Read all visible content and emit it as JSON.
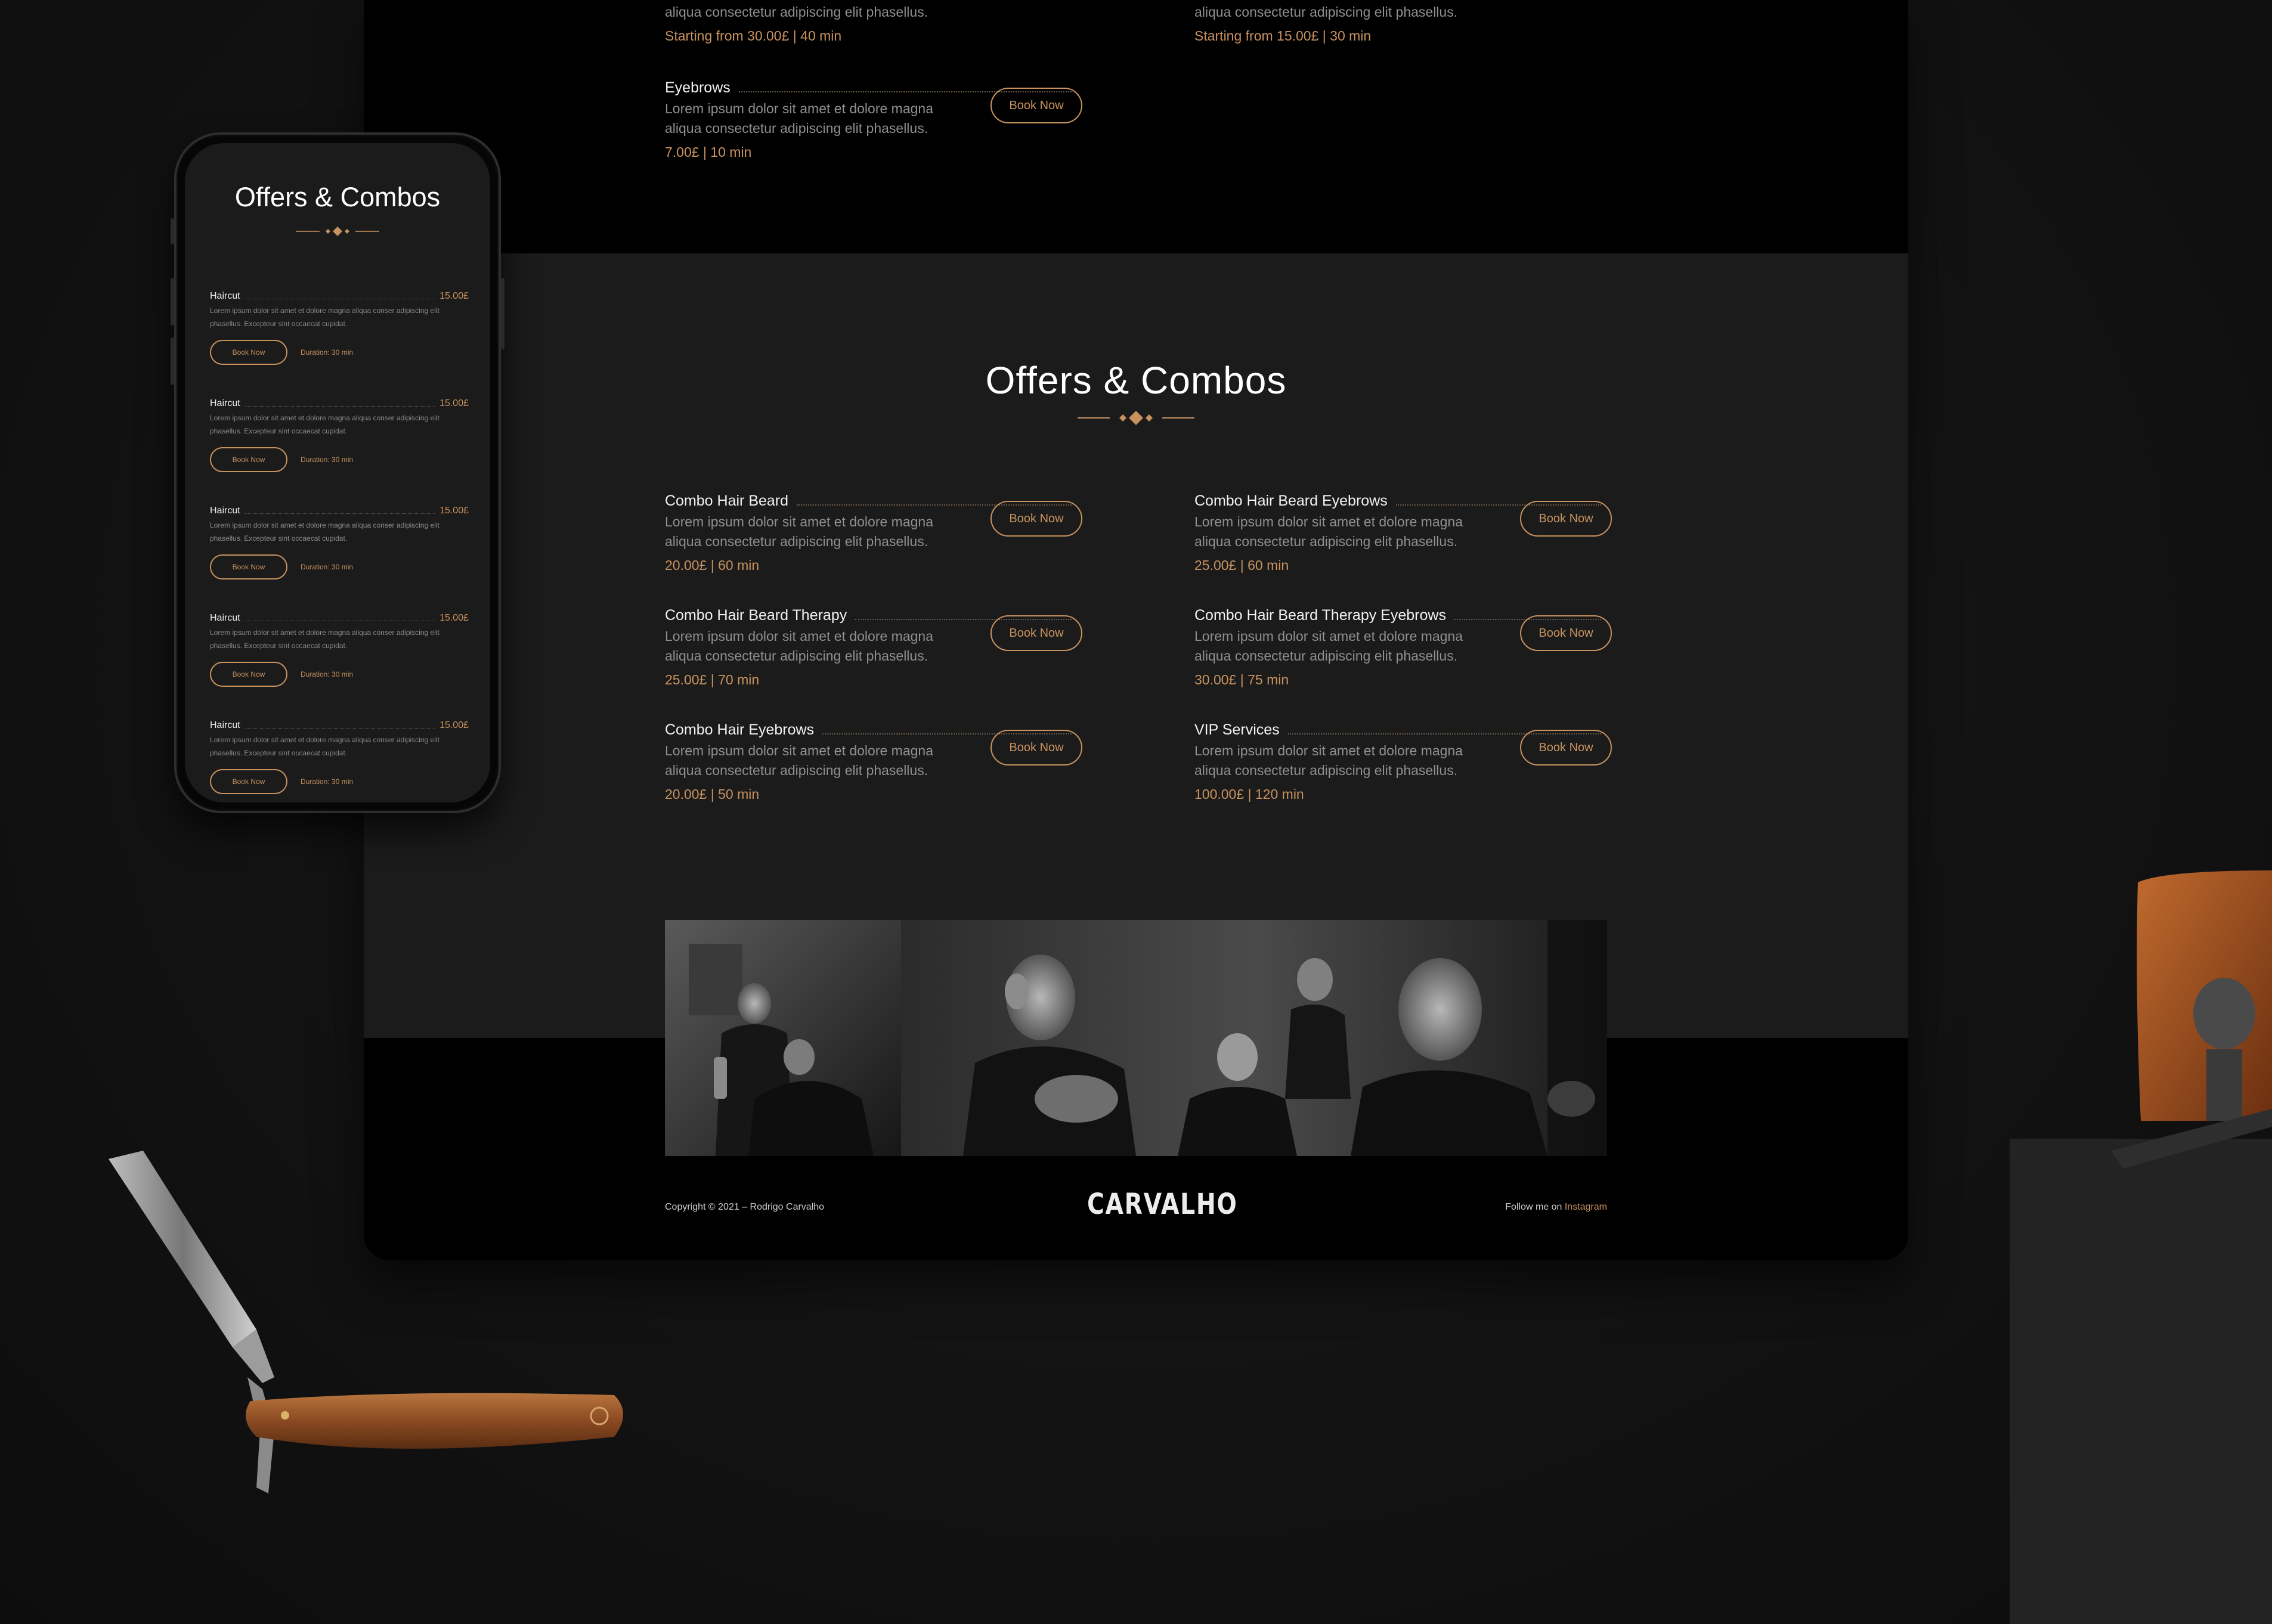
{
  "colors": {
    "accent": "#c8925f",
    "background": "#141414",
    "section_dark": "#000000",
    "section_gray": "#1b1b1b"
  },
  "top_services": {
    "items": [
      {
        "name": "",
        "description_line2": "aliqua consectetur adipiscing elit phasellus.",
        "price": "Starting from 30.00£ | 40 min"
      },
      {
        "name": "",
        "description_line2": "aliqua consectetur adipiscing elit phasellus.",
        "price": "Starting from 15.00£ | 30 min"
      },
      {
        "name": "Eyebrows",
        "description": "Lorem ipsum dolor sit amet et dolore magna aliqua consectetur adipiscing elit phasellus.",
        "price": "7.00£ | 10 min",
        "button": "Book Now"
      }
    ]
  },
  "offers": {
    "title": "Offers & Combos",
    "items": [
      {
        "name": "Combo Hair Beard",
        "description": "Lorem ipsum dolor sit amet et dolore magna aliqua consectetur adipiscing elit phasellus.",
        "price": "20.00£ | 60 min",
        "button": "Book Now"
      },
      {
        "name": "Combo Hair Beard Eyebrows",
        "description": "Lorem ipsum dolor sit amet et dolore magna aliqua consectetur adipiscing elit phasellus.",
        "price": "25.00£ | 60 min",
        "button": "Book Now"
      },
      {
        "name": "Combo Hair Beard Therapy",
        "description": "Lorem ipsum dolor sit amet et dolore magna aliqua consectetur adipiscing elit phasellus.",
        "price": "25.00£ | 70 min",
        "button": "Book Now"
      },
      {
        "name": "Combo Hair Beard Therapy Eyebrows",
        "description": "Lorem ipsum dolor sit amet et dolore magna aliqua consectetur adipiscing elit phasellus.",
        "price": "30.00£ | 75 min",
        "button": "Book Now"
      },
      {
        "name": "Combo Hair Eyebrows",
        "description": "Lorem ipsum dolor sit amet et dolore magna aliqua consectetur adipiscing elit phasellus.",
        "price": "20.00£ | 50 min",
        "button": "Book Now"
      },
      {
        "name": "VIP Services",
        "description": "Lorem ipsum dolor sit amet et dolore magna aliqua consectetur adipiscing elit phasellus.",
        "price": "100.00£ | 120 min",
        "button": "Book Now"
      }
    ]
  },
  "footer": {
    "copyright": "Copyright © 2021 – Rodrigo Carvalho",
    "logo": "CARVALHO",
    "follow_text": "Follow me on ",
    "follow_link": "Instagram"
  },
  "mobile": {
    "title": "Offers & Combos",
    "items": [
      {
        "name": "Haircut",
        "price": "15.00£",
        "description": "Lorem ipsum dolor sit amet et dolore magna aliqua conser adipiscing elit phasellus. Excepteur sint occaecat cupidat.",
        "button": "Book Now",
        "duration": "Duration: 30 min"
      },
      {
        "name": "Haircut",
        "price": "15.00£",
        "description": "Lorem ipsum dolor sit amet et dolore magna aliqua conser adipiscing elit phasellus. Excepteur sint occaecat cupidat.",
        "button": "Book Now",
        "duration": "Duration: 30 min"
      },
      {
        "name": "Haircut",
        "price": "15.00£",
        "description": "Lorem ipsum dolor sit amet et dolore magna aliqua conser adipiscing elit phasellus. Excepteur sint occaecat cupidat.",
        "button": "Book Now",
        "duration": "Duration: 30 min"
      },
      {
        "name": "Haircut",
        "price": "15.00£",
        "description": "Lorem ipsum dolor sit amet et dolore magna aliqua conser adipiscing elit phasellus. Excepteur sint occaecat cupidat.",
        "button": "Book Now",
        "duration": "Duration: 30 min"
      },
      {
        "name": "Haircut",
        "price": "15.00£",
        "description": "Lorem ipsum dolor sit amet et dolore magna aliqua conser adipiscing elit phasellus. Excepteur sint occaecat cupidat.",
        "button": "Book Now",
        "duration": "Duration: 30 min"
      }
    ]
  }
}
